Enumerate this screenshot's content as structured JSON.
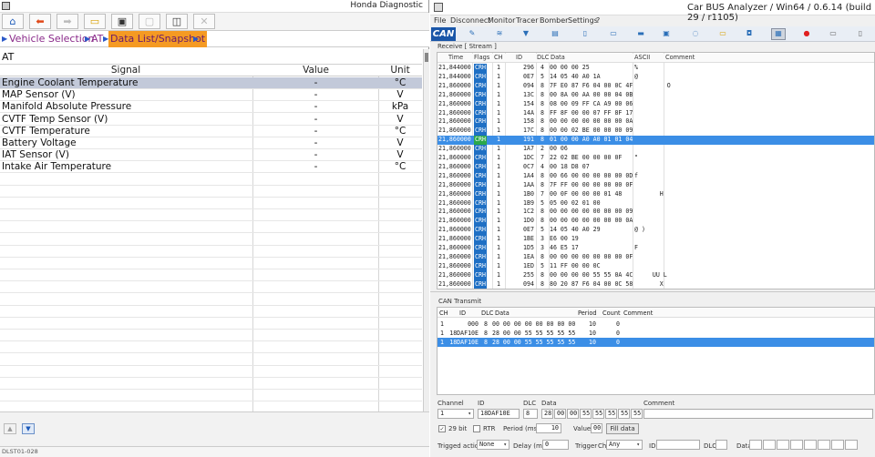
{
  "left": {
    "title": "Honda Diagnostic",
    "breadcrumb": [
      "Vehicle Selection",
      "AT",
      "Data List/Snapshot"
    ],
    "section": "AT",
    "columns": [
      "Signal",
      "Value",
      "Unit"
    ],
    "rows": [
      {
        "signal": "Engine Coolant Temperature",
        "value": "-",
        "unit": "°C"
      },
      {
        "signal": "MAP Sensor (V)",
        "value": "-",
        "unit": "V"
      },
      {
        "signal": "Manifold Absolute Pressure",
        "value": "-",
        "unit": "kPa"
      },
      {
        "signal": "CVTF Temp Sensor (V)",
        "value": "-",
        "unit": "V"
      },
      {
        "signal": "CVTF Temperature",
        "value": "-",
        "unit": "°C"
      },
      {
        "signal": "Battery Voltage",
        "value": "-",
        "unit": "V"
      },
      {
        "signal": "IAT Sensor (V)",
        "value": "-",
        "unit": "V"
      },
      {
        "signal": "Intake Air Temperature",
        "value": "-",
        "unit": "°C"
      }
    ],
    "status": "DLST01-028",
    "nav_up": "▲",
    "nav_down": "▼"
  },
  "right": {
    "title": "Car BUS Analyzer / Win64 / 0.6.14 (build 29 / r1105)",
    "menu": [
      "File",
      "Disconnect",
      "Monitor",
      "Tracer",
      "Bomber",
      "Settings",
      "?"
    ],
    "logo": "CAN",
    "receive_label": "Receive [ Stream ]",
    "rx_columns": [
      "Time",
      "Flags",
      "CH",
      "ID",
      "DLC",
      "Data",
      "ASCII",
      "Comment"
    ],
    "rx_rows": [
      {
        "time": "21,844000",
        "flag": "CRH",
        "ch": "1",
        "id": "296",
        "dlc": "4",
        "data": "00 00 00 25",
        "ascii": "%"
      },
      {
        "time": "21,844000",
        "flag": "CRH",
        "ch": "1",
        "id": "0E7",
        "dlc": "5",
        "data": "14 05 40 A0 1A",
        "ascii": "@"
      },
      {
        "time": "21,860000",
        "flag": "CRH",
        "ch": "1",
        "id": "094",
        "dlc": "8",
        "data": "7F E0 87 F6 04 00 0C 4F",
        "ascii": "         O"
      },
      {
        "time": "21,860000",
        "flag": "CRH",
        "ch": "1",
        "id": "13C",
        "dlc": "8",
        "data": "00 8A 00 AA 00 00 04 0B",
        "ascii": ""
      },
      {
        "time": "21,860000",
        "flag": "CRH",
        "ch": "1",
        "id": "154",
        "dlc": "8",
        "data": "08 00 09 FF CA A9 00 06",
        "ascii": ""
      },
      {
        "time": "21,860000",
        "flag": "CRH",
        "ch": "1",
        "id": "14A",
        "dlc": "8",
        "data": "FF 8F 00 00 07 FF 8F 17",
        "ascii": ""
      },
      {
        "time": "21,860000",
        "flag": "CRH",
        "ch": "1",
        "id": "158",
        "dlc": "8",
        "data": "00 00 00 00 00 00 00 0A",
        "ascii": ""
      },
      {
        "time": "21,860000",
        "flag": "CRH",
        "ch": "1",
        "id": "17C",
        "dlc": "8",
        "data": "00 00 02 BE 00 00 00 09",
        "ascii": ""
      },
      {
        "time": "21,860000",
        "flag": "CRH",
        "ch": "1",
        "id": "191",
        "dlc": "8",
        "data": "01 00 00 A0 A0 01 01 04",
        "ascii": ""
      },
      {
        "time": "21,860000",
        "flag": "CRH",
        "ch": "1",
        "id": "1A7",
        "dlc": "2",
        "data": "00 06",
        "ascii": ""
      },
      {
        "time": "21,860000",
        "flag": "CRH",
        "ch": "1",
        "id": "1DC",
        "dlc": "7",
        "data": "22 02 BE 00 00 00 0F",
        "ascii": "\""
      },
      {
        "time": "21,860000",
        "flag": "CRH",
        "ch": "1",
        "id": "0C7",
        "dlc": "4",
        "data": "00 18 D8 07",
        "ascii": ""
      },
      {
        "time": "21,860000",
        "flag": "CRH",
        "ch": "1",
        "id": "1A4",
        "dlc": "8",
        "data": "00 66 00 00 00 00 00 0D",
        "ascii": "f"
      },
      {
        "time": "21,860000",
        "flag": "CRH",
        "ch": "1",
        "id": "1AA",
        "dlc": "8",
        "data": "7F FF 00 00 00 00 00 0F",
        "ascii": ""
      },
      {
        "time": "21,860000",
        "flag": "CRH",
        "ch": "1",
        "id": "1B0",
        "dlc": "7",
        "data": "00 0F 00 00 00 01 48",
        "ascii": "       H"
      },
      {
        "time": "21,860000",
        "flag": "CRH",
        "ch": "1",
        "id": "1B9",
        "dlc": "5",
        "data": "05 00 02 01 00",
        "ascii": ""
      },
      {
        "time": "21,860000",
        "flag": "CRH",
        "ch": "1",
        "id": "1C2",
        "dlc": "8",
        "data": "00 00 00 00 00 00 00 09",
        "ascii": ""
      },
      {
        "time": "21,860000",
        "flag": "CRH",
        "ch": "1",
        "id": "1D0",
        "dlc": "8",
        "data": "00 00 00 00 00 00 00 0A",
        "ascii": ""
      },
      {
        "time": "21,860000",
        "flag": "CRH",
        "ch": "1",
        "id": "0E7",
        "dlc": "5",
        "data": "14 05 40 A0 29",
        "ascii": "@ )"
      },
      {
        "time": "21,860000",
        "flag": "CRH",
        "ch": "1",
        "id": "1BE",
        "dlc": "3",
        "data": "E6 00 19",
        "ascii": ""
      },
      {
        "time": "21,860000",
        "flag": "CRH",
        "ch": "1",
        "id": "1D5",
        "dlc": "3",
        "data": "46 E5 17",
        "ascii": "F"
      },
      {
        "time": "21,860000",
        "flag": "CRH",
        "ch": "1",
        "id": "1EA",
        "dlc": "8",
        "data": "00 00 00 00 00 00 00 0F",
        "ascii": ""
      },
      {
        "time": "21,860000",
        "flag": "CRH",
        "ch": "1",
        "id": "1ED",
        "dlc": "5",
        "data": "11 FF 00 00 0C",
        "ascii": ""
      },
      {
        "time": "21,860000",
        "flag": "CRH",
        "ch": "1",
        "id": "255",
        "dlc": "8",
        "data": "00 00 00 00 55 55 0A 4C",
        "ascii": "     UU L"
      },
      {
        "time": "21,860000",
        "flag": "CRH",
        "ch": "1",
        "id": "094",
        "dlc": "8",
        "data": "80 20 87 F6 04 00 0C 58",
        "ascii": "       X"
      }
    ],
    "transmit_label": "CAN Transmit",
    "tx_columns": [
      "CH",
      "ID",
      "DLC",
      "Data",
      "Period",
      "Count",
      "Comment"
    ],
    "tx_rows": [
      {
        "ch": "1",
        "id": "000",
        "dlc": "8",
        "data": "00 00 00 00 00 00 00 00",
        "period": "10",
        "count": "0"
      },
      {
        "ch": "1",
        "id": "18DAF10E",
        "dlc": "8",
        "data": "28 00 00 55 55 55 55 55",
        "period": "10",
        "count": "0"
      },
      {
        "ch": "1",
        "id": "18DAF10E",
        "dlc": "8",
        "data": "28 00 00 55 55 55 55 55",
        "period": "10",
        "count": "0"
      }
    ],
    "form": {
      "channel_label": "Channel",
      "channel_value": "1",
      "id_label": "ID",
      "id_value": "18DAF10E",
      "dlc_label": "DLC",
      "dlc_value": "8",
      "data_label": "Data",
      "data_bytes": [
        "28",
        "00",
        "00",
        "55",
        "55",
        "55",
        "55",
        "55"
      ],
      "comment_label": "Comment",
      "bit29_label": "29 bit",
      "rtr_label": "RTR",
      "period_label": "Period (ms)",
      "period_value": "10",
      "value_label": "Value",
      "value_value": "00",
      "fill_button": "Fill data",
      "trigged_label": "Trigged action",
      "trigged_value": "None",
      "delay_label": "Delay (ms)",
      "delay_value": "0",
      "trigger_label": "Trigger",
      "ch_label": "Ch",
      "ch_value": "Any",
      "id2_label": "ID",
      "dlc2_label": "DLC",
      "data2_label": "Data"
    }
  }
}
